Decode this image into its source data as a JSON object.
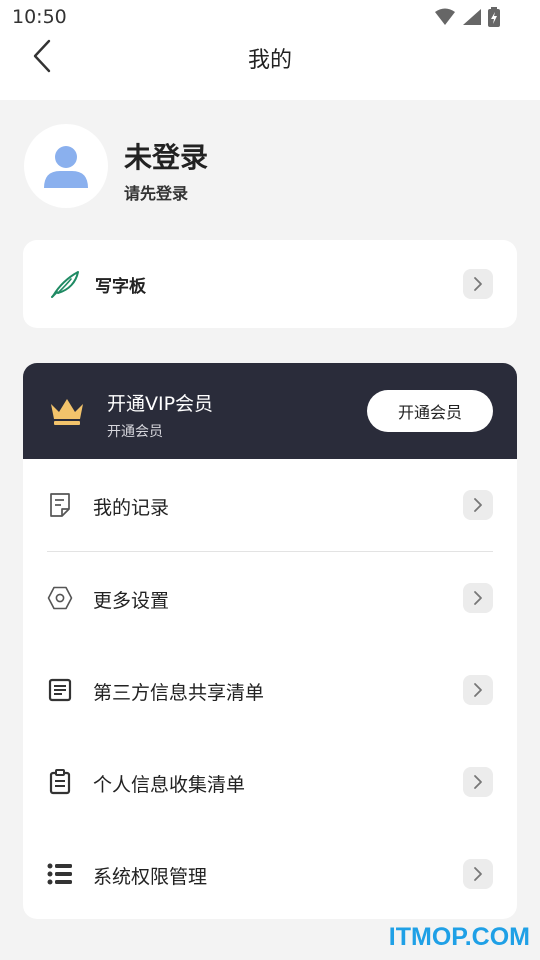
{
  "status_bar": {
    "time": "10:50"
  },
  "nav": {
    "title": "我的"
  },
  "profile": {
    "name": "未登录",
    "subtitle": "请先登录"
  },
  "writing_pad": {
    "label": "写字板"
  },
  "vip": {
    "title": "开通VIP会员",
    "subtitle": "开通会员",
    "button_label": "开通会员",
    "background_color": "#2a2c3a",
    "crown_color": "#f2c36b"
  },
  "menu": [
    {
      "label": "我的记录",
      "icon": "record-icon"
    },
    {
      "label": "更多设置",
      "icon": "settings-icon"
    },
    {
      "label": "第三方信息共享清单",
      "icon": "document-icon"
    },
    {
      "label": "个人信息收集清单",
      "icon": "clipboard-icon"
    },
    {
      "label": "系统权限管理",
      "icon": "list-icon"
    }
  ],
  "watermark": "ITMOP.COM"
}
